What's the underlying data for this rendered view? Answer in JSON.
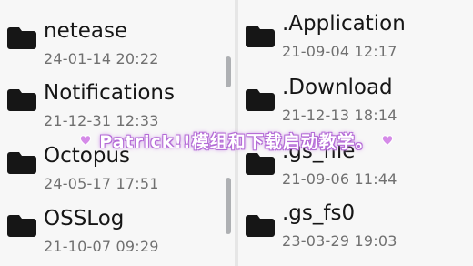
{
  "left_panel": {
    "items": [
      {
        "name": "netease",
        "date": "24-01-14 20:22"
      },
      {
        "name": "Notifications",
        "date": "21-12-31 12:33"
      },
      {
        "name": "Octopus",
        "date": "24-05-17 17:51"
      },
      {
        "name": "OSSLog",
        "date": "21-10-07 09:29"
      }
    ]
  },
  "right_panel": {
    "items": [
      {
        "name": ".Application",
        "date": "21-09-04 12:17"
      },
      {
        "name": ".Download",
        "date": "21-12-13 18:14"
      },
      {
        "name": ".gs_file",
        "date": "21-09-06 11:44"
      },
      {
        "name": ".gs_fs0",
        "date": "23-03-29 19:03"
      }
    ]
  },
  "overlay_banner": {
    "text": "Patrick!!模组和下载启动教学。"
  },
  "colors": {
    "folder": "#161616",
    "accent_text": "#ffffff",
    "banner_glow": "#c27be0",
    "heart": "#d58be8"
  },
  "icons": [
    "folder-icon",
    "heart-icon"
  ]
}
